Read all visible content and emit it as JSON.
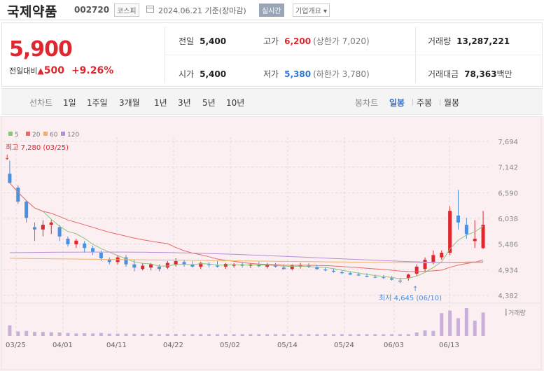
{
  "stock": {
    "name": "국제약품",
    "code": "002720",
    "market": "코스피",
    "date": "2024.06.21",
    "date_suffix": "기준(장마감)",
    "realtime_label": "실시간",
    "overview_label": "기업개요"
  },
  "price": {
    "current": "5,900",
    "change_label": "전일대비",
    "change_amount": "500",
    "change_pct": "+9.26%"
  },
  "stats": {
    "prev_close_label": "전일",
    "prev_close": "5,400",
    "open_label": "시가",
    "open": "5,400",
    "high_label": "고가",
    "high": "6,200",
    "upper_limit": "(상한가 7,020)",
    "low_label": "저가",
    "low": "5,380",
    "lower_limit": "(하한가 3,780)",
    "volume_label": "거래량",
    "volume": "13,287,221",
    "value_label": "거래대금",
    "value": "78,363",
    "value_unit": "백만"
  },
  "periods": {
    "label": "선차트",
    "items": [
      "1일",
      "1주일",
      "3개월",
      "1년",
      "3년",
      "5년",
      "10년"
    ],
    "candle_label": "봉차트",
    "candle_items": [
      "일봉",
      "주봉",
      "월봉"
    ],
    "selected_candle": "일봉"
  },
  "colors": {
    "up": "#e0262e",
    "down": "#4a8fe0",
    "ma5": "#8cc47a",
    "ma20": "#e86a6a",
    "ma60": "#f0b06a",
    "ma120": "#b58fd6"
  },
  "chart_data": {
    "type": "candlestick",
    "legend": [
      "5",
      "20",
      "60",
      "120"
    ],
    "y_ticks": [
      7694,
      7142,
      6590,
      6038,
      5486,
      4934,
      4382
    ],
    "ylim": [
      4382,
      7694
    ],
    "x_labels": [
      "03/25",
      "04/01",
      "04/11",
      "04/22",
      "05/02",
      "05/14",
      "05/24",
      "06/03",
      "06/13"
    ],
    "high_annotation": "최고 7,280 (03/25)",
    "low_annotation": "최저 4,645 (06/10)",
    "volume_label": "거래량",
    "candles": [
      [
        7000,
        7280,
        6900,
        6800
      ],
      [
        6700,
        6750,
        6350,
        6400
      ],
      [
        6400,
        6420,
        5950,
        6050
      ],
      [
        5850,
        5950,
        5550,
        5800
      ],
      [
        5800,
        6000,
        5650,
        5900
      ],
      [
        5900,
        6000,
        5700,
        5950
      ],
      [
        5850,
        5900,
        5550,
        5650
      ],
      [
        5600,
        5650,
        5430,
        5480
      ],
      [
        5480,
        5600,
        5400,
        5560
      ],
      [
        5500,
        5550,
        5300,
        5400
      ],
      [
        5400,
        5450,
        5250,
        5320
      ],
      [
        5300,
        5350,
        5120,
        5180
      ],
      [
        5150,
        5200,
        5050,
        5100
      ],
      [
        5100,
        5250,
        5050,
        5200
      ],
      [
        5200,
        5250,
        5000,
        5050
      ],
      [
        5050,
        5150,
        4900,
        4980
      ],
      [
        4950,
        5080,
        4920,
        5020
      ],
      [
        4980,
        5080,
        4920,
        5050
      ],
      [
        5000,
        5050,
        4900,
        4950
      ],
      [
        4980,
        5120,
        4950,
        5080
      ],
      [
        5050,
        5180,
        5000,
        5120
      ],
      [
        5100,
        5150,
        5000,
        5050
      ],
      [
        5050,
        5120,
        4980,
        5000
      ],
      [
        5000,
        5100,
        4950,
        5080
      ],
      [
        5050,
        5100,
        4980,
        5040
      ],
      [
        5020,
        5120,
        4980,
        5000
      ],
      [
        5000,
        5080,
        4950,
        5060
      ],
      [
        5020,
        5080,
        4980,
        5050
      ],
      [
        5050,
        5100,
        4980,
        5020
      ],
      [
        5020,
        5080,
        4970,
        5050
      ],
      [
        5040,
        5100,
        4990,
        5010
      ],
      [
        5000,
        5080,
        4960,
        5050
      ],
      [
        5040,
        5080,
        4980,
        5000
      ],
      [
        4980,
        5050,
        4930,
        4950
      ],
      [
        4950,
        5050,
        4920,
        5020
      ],
      [
        5000,
        5080,
        4960,
        5030
      ],
      [
        5020,
        5070,
        4970,
        5000
      ],
      [
        4990,
        5040,
        4930,
        4950
      ],
      [
        4940,
        4990,
        4900,
        4920
      ],
      [
        4910,
        4960,
        4870,
        4890
      ],
      [
        4880,
        4930,
        4840,
        4860
      ],
      [
        4860,
        4900,
        4820,
        4830
      ],
      [
        4830,
        4880,
        4800,
        4810
      ],
      [
        4800,
        4860,
        4770,
        4780
      ],
      [
        4780,
        4830,
        4750,
        4770
      ],
      [
        4770,
        4820,
        4740,
        4760
      ],
      [
        4750,
        4800,
        4700,
        4720
      ],
      [
        4700,
        4760,
        4645,
        4680
      ],
      [
        4750,
        4850,
        4700,
        4830
      ],
      [
        4850,
        5050,
        4800,
        5000
      ],
      [
        4950,
        5200,
        4900,
        5150
      ],
      [
        5100,
        5350,
        5050,
        5250
      ],
      [
        5200,
        5350,
        5150,
        5300
      ],
      [
        5300,
        6300,
        5250,
        6200
      ],
      [
        6100,
        6650,
        5800,
        5950
      ],
      [
        5900,
        6050,
        5600,
        5700
      ],
      [
        5550,
        6000,
        5400,
        5600
      ],
      [
        5400,
        6200,
        5380,
        5900
      ]
    ],
    "volumes": [
      42,
      18,
      20,
      16,
      16,
      15,
      14,
      12,
      10,
      11,
      10,
      12,
      9,
      9,
      9,
      8,
      8,
      8,
      7,
      8,
      8,
      7,
      7,
      7,
      7,
      7,
      7,
      7,
      7,
      7,
      7,
      7,
      7,
      7,
      7,
      7,
      7,
      7,
      7,
      7,
      7,
      7,
      7,
      7,
      7,
      7,
      7,
      7,
      7,
      14,
      22,
      20,
      90,
      100,
      70,
      110,
      60,
      92
    ]
  }
}
